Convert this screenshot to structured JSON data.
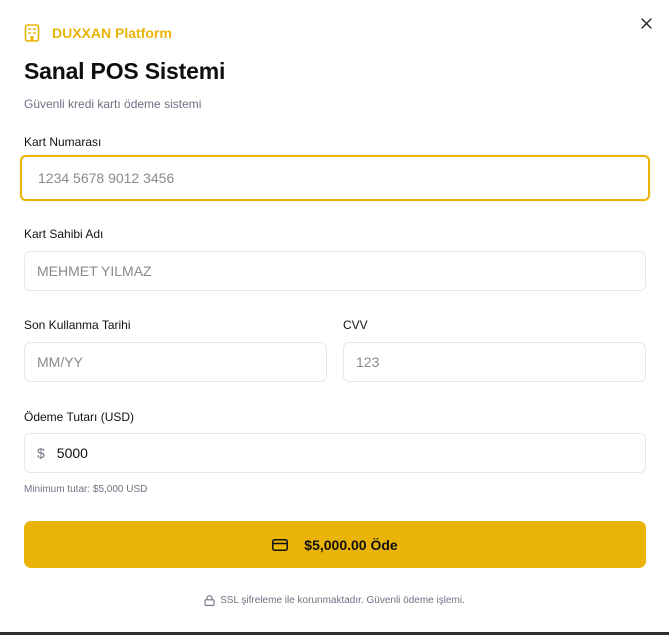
{
  "brand": {
    "name": "DUXXAN Platform",
    "icon": "building-icon",
    "color": "#eab308"
  },
  "dialog": {
    "title": "Sanal POS Sistemi",
    "subtitle": "Güvenli kredi kartı ödeme sistemi",
    "close_icon": "close-icon"
  },
  "form": {
    "card_number": {
      "label": "Kart Numarası",
      "placeholder": "1234 5678 9012 3456",
      "value": ""
    },
    "card_holder": {
      "label": "Kart Sahibi Adı",
      "placeholder": "MEHMET YILMAZ",
      "value": ""
    },
    "expiry": {
      "label": "Son Kullanma Tarihi",
      "placeholder": "MM/YY",
      "value": ""
    },
    "cvv": {
      "label": "CVV",
      "placeholder": "123",
      "value": ""
    },
    "amount": {
      "label": "Ödeme Tutarı (USD)",
      "currency_symbol": "$",
      "value": "5000",
      "hint": "Minimum tutar: $5,000 USD"
    }
  },
  "pay_button": {
    "label": "$5,000.00 Öde",
    "icon": "credit-card-icon"
  },
  "footer": {
    "secure_text": "SSL şifreleme ile korunmaktadır. Güvenli ödeme işlemi.",
    "icon": "lock-icon"
  }
}
